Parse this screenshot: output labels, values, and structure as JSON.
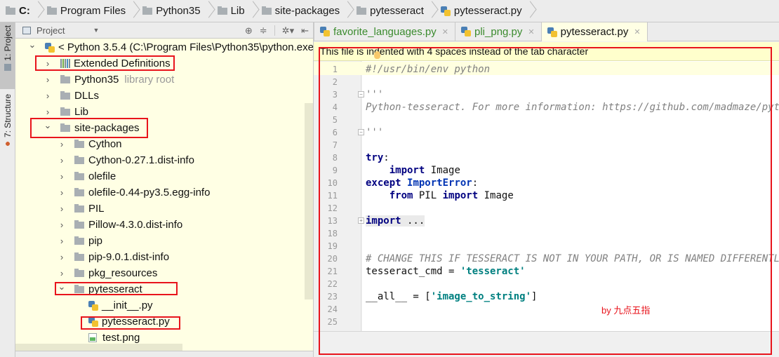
{
  "breadcrumb": [
    {
      "label": "C:",
      "bold": true
    },
    {
      "label": "Program Files"
    },
    {
      "label": "Python35"
    },
    {
      "label": "Lib"
    },
    {
      "label": "site-packages"
    },
    {
      "label": "pytesseract"
    },
    {
      "label": "pytesseract.py",
      "icon": "python-file-icon"
    }
  ],
  "toolstrip": {
    "project_tab": "1: Project",
    "structure_tab": "7: Structure"
  },
  "project_panel": {
    "title": "Project",
    "tools": [
      "locate-icon",
      "collapse-all-icon",
      "settings-icon",
      "hide-panel-icon"
    ]
  },
  "tree": [
    {
      "label": "< Python 3.5.4 (C:\\Program Files\\Python35\\python.exe",
      "indent": 0,
      "arrow": "expanded",
      "icon": "python-sdk-icon"
    },
    {
      "label": "Extended Definitions",
      "indent": 1,
      "arrow": "collapsed",
      "icon": "library-icon",
      "highlighted": true
    },
    {
      "label": "Python35",
      "hint": "library root",
      "indent": 1,
      "arrow": "collapsed",
      "icon": "folder-icon"
    },
    {
      "label": "DLLs",
      "indent": 1,
      "arrow": "collapsed",
      "icon": "folder-icon"
    },
    {
      "label": "Lib",
      "indent": 1,
      "arrow": "collapsed",
      "icon": "folder-icon"
    },
    {
      "label": "site-packages",
      "indent": 1,
      "arrow": "expanded",
      "icon": "folder-icon",
      "highlighted": true
    },
    {
      "label": "Cython",
      "indent": 2,
      "arrow": "collapsed",
      "icon": "folder-icon"
    },
    {
      "label": "Cython-0.27.1.dist-info",
      "indent": 2,
      "arrow": "collapsed",
      "icon": "folder-icon"
    },
    {
      "label": "olefile",
      "indent": 2,
      "arrow": "collapsed",
      "icon": "folder-icon"
    },
    {
      "label": "olefile-0.44-py3.5.egg-info",
      "indent": 2,
      "arrow": "collapsed",
      "icon": "folder-icon"
    },
    {
      "label": "PIL",
      "indent": 2,
      "arrow": "collapsed",
      "icon": "folder-icon"
    },
    {
      "label": "Pillow-4.3.0.dist-info",
      "indent": 2,
      "arrow": "collapsed",
      "icon": "folder-icon"
    },
    {
      "label": "pip",
      "indent": 2,
      "arrow": "collapsed",
      "icon": "folder-icon"
    },
    {
      "label": "pip-9.0.1.dist-info",
      "indent": 2,
      "arrow": "collapsed",
      "icon": "folder-icon"
    },
    {
      "label": "pkg_resources",
      "indent": 2,
      "arrow": "collapsed",
      "icon": "folder-icon"
    },
    {
      "label": "pytesseract",
      "indent": 2,
      "arrow": "expanded",
      "icon": "folder-icon",
      "highlighted": true
    },
    {
      "label": "__init__.py",
      "indent": 3,
      "arrow": "none",
      "icon": "python-file-icon"
    },
    {
      "label": "pytesseract.py",
      "indent": 3,
      "arrow": "none",
      "icon": "python-file-icon",
      "highlighted": true
    },
    {
      "label": "test.png",
      "indent": 3,
      "arrow": "none",
      "icon": "image-file-icon"
    }
  ],
  "tabs": [
    {
      "label": "favorite_languages.py",
      "active": false
    },
    {
      "label": "pli_png.py",
      "active": false
    },
    {
      "label": "pytesseract.py",
      "active": true
    }
  ],
  "notice": "This file is indented with 4 spaces instead of the tab character",
  "code": [
    {
      "n": "1",
      "tokens": [
        [
          "cmt",
          "#!/usr/bin/env python"
        ]
      ]
    },
    {
      "n": "2",
      "tokens": []
    },
    {
      "n": "3",
      "tokens": [
        [
          "cmt",
          "'''"
        ]
      ],
      "fold": "open"
    },
    {
      "n": "4",
      "tokens": [
        [
          "cmt",
          "Python-tesseract. For more information: https://github.com/madmaze/pytesseract"
        ]
      ]
    },
    {
      "n": "5",
      "tokens": []
    },
    {
      "n": "6",
      "tokens": [
        [
          "cmt",
          "'''"
        ]
      ],
      "fold": "close"
    },
    {
      "n": "7",
      "tokens": []
    },
    {
      "n": "8",
      "tokens": [
        [
          "kw",
          "try"
        ],
        [
          "",
          ":"
        ]
      ]
    },
    {
      "n": "9",
      "tokens": [
        [
          "",
          "    "
        ],
        [
          "kw",
          "import"
        ],
        [
          "",
          " Image"
        ]
      ]
    },
    {
      "n": "10",
      "tokens": [
        [
          "kw",
          "except"
        ],
        [
          "",
          " "
        ],
        [
          "cls",
          "ImportError"
        ],
        [
          "",
          ":"
        ]
      ]
    },
    {
      "n": "11",
      "tokens": [
        [
          "",
          "    "
        ],
        [
          "kw",
          "from"
        ],
        [
          "",
          " PIL "
        ],
        [
          "kw",
          "import"
        ],
        [
          "",
          " Image"
        ]
      ]
    },
    {
      "n": "12",
      "tokens": []
    },
    {
      "n": "13",
      "tokens": [
        [
          "fold-pill kw",
          "import"
        ],
        [
          "fold-pill",
          " ..."
        ]
      ],
      "fold": "collapsed"
    },
    {
      "n": "18",
      "tokens": []
    },
    {
      "n": "19",
      "tokens": []
    },
    {
      "n": "20",
      "tokens": [
        [
          "cmt",
          "# CHANGE THIS IF TESSERACT IS NOT IN YOUR PATH, OR IS NAMED DIFFERENTLY"
        ]
      ]
    },
    {
      "n": "21",
      "tokens": [
        [
          "",
          "tesseract_cmd = "
        ],
        [
          "str",
          "'tesseract'"
        ]
      ]
    },
    {
      "n": "22",
      "tokens": []
    },
    {
      "n": "23",
      "tokens": [
        [
          "",
          "__all__ = ["
        ],
        [
          "str",
          "'image_to_string'"
        ],
        [
          "",
          "]"
        ]
      ]
    },
    {
      "n": "24",
      "tokens": []
    },
    {
      "n": "25",
      "tokens": []
    }
  ],
  "watermark": "by 九点五指",
  "colors": {
    "highlight_box": "#e8141c",
    "tree_bg": "#ffffe4",
    "notice_bg": "#ffffcc",
    "inactive_tab_text": "#3b8b2e"
  }
}
